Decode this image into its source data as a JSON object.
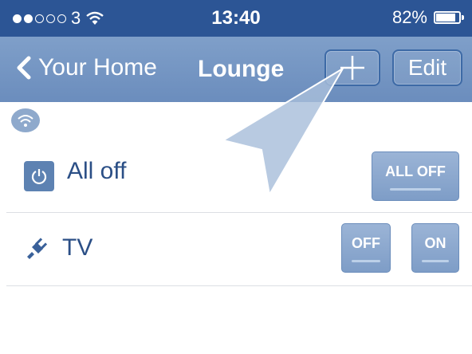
{
  "status": {
    "carrier": "3",
    "time": "13:40",
    "battery_percent": "82%"
  },
  "nav": {
    "back_label": "Your Home",
    "title": "Lounge",
    "add_label": "+",
    "edit_label": "Edit"
  },
  "rows": [
    {
      "label": "All off",
      "icon": "power-icon",
      "controls": [
        "ALL OFF"
      ]
    },
    {
      "label": "TV",
      "icon": "plug-icon",
      "controls": [
        "OFF",
        "ON"
      ]
    }
  ],
  "colors": {
    "status_bg": "#2c5595",
    "nav_bg": "#7396c3",
    "text": "#2b4f86",
    "button": "#8aa8cf"
  }
}
